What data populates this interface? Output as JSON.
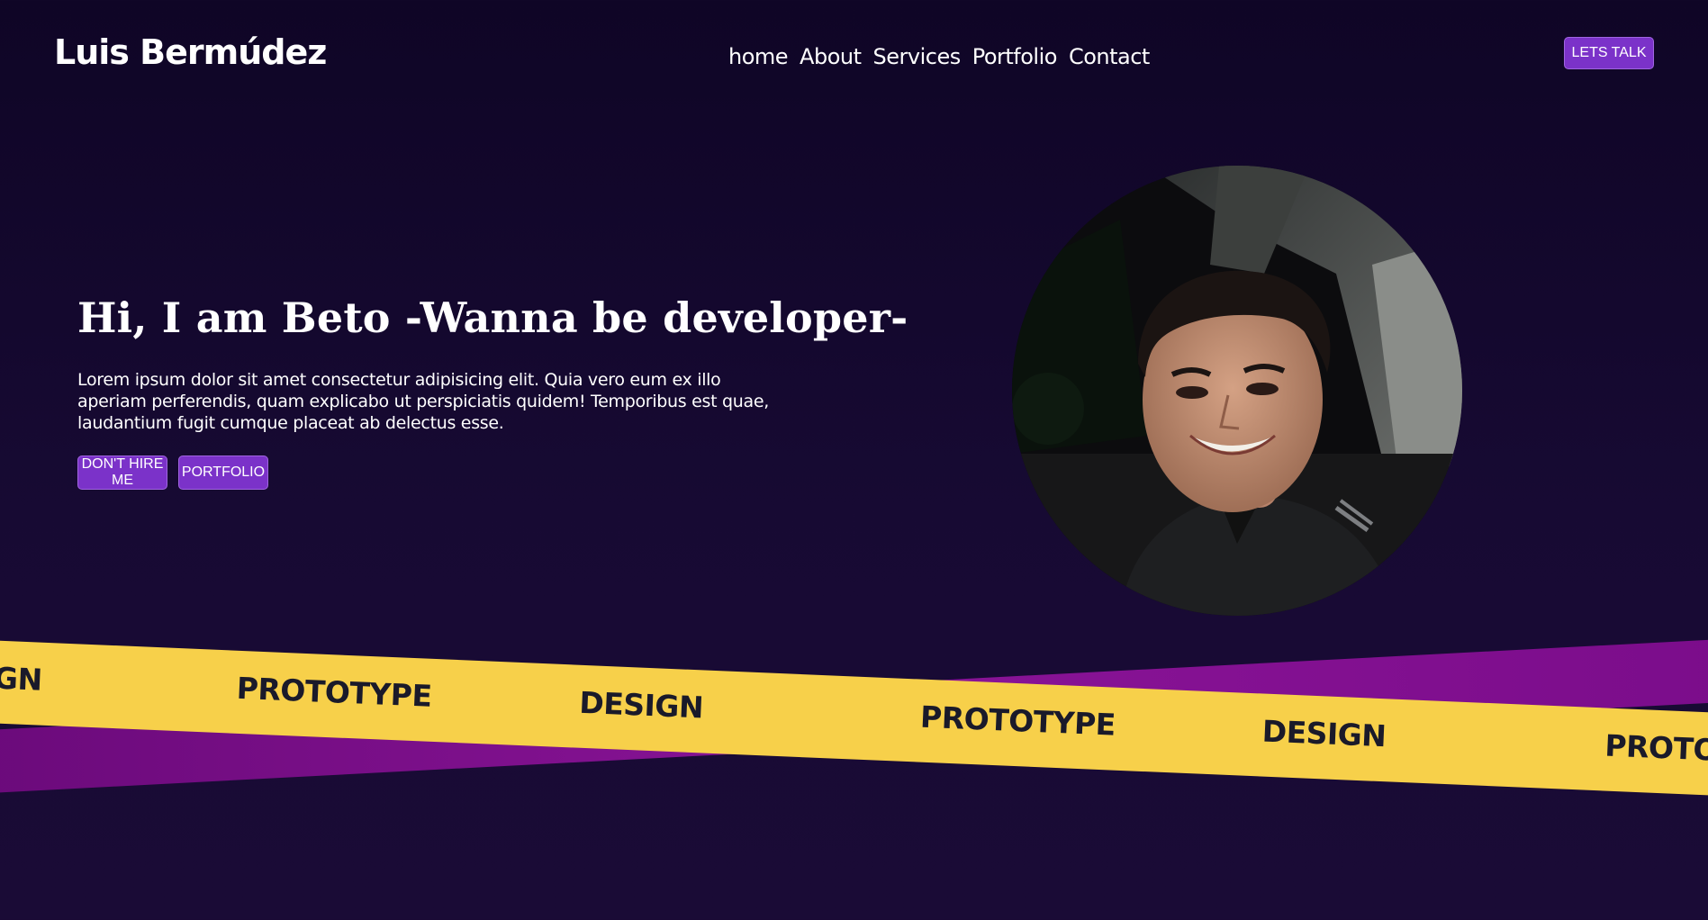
{
  "header": {
    "brand": "Luis Bermúdez",
    "nav": [
      "home",
      "About",
      "Services",
      "Portfolio",
      "Contact"
    ],
    "cta": "LETS TALK"
  },
  "hero": {
    "title": "Hi, I am Beto -Wanna be developer-",
    "text": "Lorem ipsum dolor sit amet consectetur adipisicing elit. Quia vero eum ex illo aperiam perferendis, quam explicabo ut perspiciatis quidem! Temporibus est quae, laudantium fugit cumque placeat ab delectus esse.",
    "buttons": {
      "hire": "DON'T HIRE ME",
      "portfolio": "PORTFOLIO"
    }
  },
  "marquee": {
    "words": [
      "GN",
      "PROTOTYPE",
      "DESIGN",
      "PROTOTYPE",
      "DESIGN",
      "PROTO"
    ]
  },
  "colors": {
    "background": "#150932",
    "accent": "#7b32c9",
    "band_yellow": "#f7d04a",
    "band_purple": "#8a1497"
  }
}
